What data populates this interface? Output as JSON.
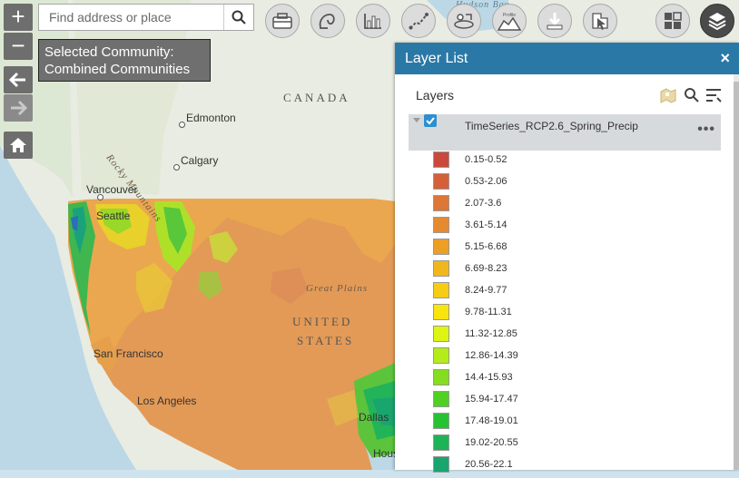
{
  "search": {
    "placeholder": "Find address or place"
  },
  "community": {
    "label": "Selected Community:",
    "value": "Combined Communities"
  },
  "map_labels": {
    "canada": "CANADA",
    "united_states_line1": "UNITED",
    "united_states_line2": "STATES",
    "great_plains": "Great Plains",
    "rocky_mountains": "Rocky Mountains",
    "hudson_bay": "Hudson Bay",
    "edmonton": "Edmonton",
    "calgary": "Calgary",
    "vancouver": "Vancouver",
    "seattle": "Seattle",
    "san_francisco": "San Francisco",
    "los_angeles": "Los Angeles",
    "dallas": "Dallas",
    "houston": "Hous"
  },
  "toolbar": {
    "tools": [
      {
        "name": "basemap-gallery-icon"
      },
      {
        "name": "measurement-icon"
      },
      {
        "name": "chart-icon"
      },
      {
        "name": "draw-icon"
      },
      {
        "name": "directions-icon"
      },
      {
        "name": "elevation-profile-icon",
        "label": "Profile"
      },
      {
        "name": "download-icon"
      },
      {
        "name": "select-icon"
      },
      {
        "name": "dashboard-icon"
      },
      {
        "name": "layers-icon"
      }
    ]
  },
  "layer_list": {
    "title": "Layer List",
    "close": "×",
    "section_title": "Layers",
    "layer_name": "TimeSeries_RCP2.6_Spring_Precip",
    "layer_checked": true,
    "menu": "•••",
    "legend": [
      {
        "label": "0.15-0.52",
        "color": "#c94a3c"
      },
      {
        "label": "0.53-2.06",
        "color": "#d4603a"
      },
      {
        "label": "2.07-3.6",
        "color": "#dd7636"
      },
      {
        "label": "3.61-5.14",
        "color": "#e58a2e"
      },
      {
        "label": "5.15-6.68",
        "color": "#ec9f25"
      },
      {
        "label": "6.69-8.23",
        "color": "#f2b61d"
      },
      {
        "label": "8.24-9.77",
        "color": "#f6cc14"
      },
      {
        "label": "9.78-11.31",
        "color": "#f8e40e"
      },
      {
        "label": "11.32-12.85",
        "color": "#def513"
      },
      {
        "label": "12.86-14.39",
        "color": "#b4ec1a"
      },
      {
        "label": "14.4-15.93",
        "color": "#84de1f"
      },
      {
        "label": "15.94-17.47",
        "color": "#4fd023"
      },
      {
        "label": "17.48-19.01",
        "color": "#27c232"
      },
      {
        "label": "19.02-20.55",
        "color": "#1cb454"
      },
      {
        "label": "20.56-22.1",
        "color": "#19a56e"
      }
    ]
  }
}
